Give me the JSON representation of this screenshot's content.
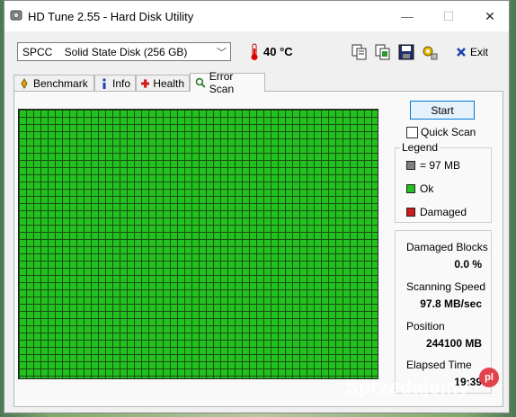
{
  "window": {
    "title": "HD Tune 2.55 - Hard Disk Utility",
    "minimize_glyph": "—",
    "maximize_glyph": "☐",
    "close_glyph": "✕"
  },
  "toolbar": {
    "drive": "SPCC    Solid State Disk (256 GB)",
    "temperature": "40 °C",
    "exit_label": "Exit",
    "icons": [
      "copy-icon",
      "copy-info-icon",
      "save-icon",
      "options-icon"
    ]
  },
  "tabs": [
    {
      "label": "Benchmark",
      "icon": "benchmark-icon"
    },
    {
      "label": "Info",
      "icon": "info-icon"
    },
    {
      "label": "Health",
      "icon": "health-icon"
    },
    {
      "label": "Error Scan",
      "icon": "search-icon",
      "active": true
    }
  ],
  "scan": {
    "start_label": "Start",
    "quick_scan_label": "Quick Scan",
    "quick_scan_checked": false,
    "block_color": "#22c21e"
  },
  "legend": {
    "title": "Legend",
    "items": [
      {
        "label": "= 97 MB",
        "color": "#808080"
      },
      {
        "label": "Ok",
        "color": "#22c21e"
      },
      {
        "label": "Damaged",
        "color": "#d11a1a"
      }
    ]
  },
  "stats": {
    "damaged_label": "Damaged Blocks",
    "damaged_value": "0.0 %",
    "speed_label": "Scanning Speed",
    "speed_value": "97.8 MB/sec",
    "position_label": "Position",
    "position_value": "244100 MB",
    "elapsed_label": "Elapsed Time",
    "elapsed_value": "19:39"
  },
  "watermark": {
    "text": "Sprzedajemy",
    "badge": "pl"
  }
}
